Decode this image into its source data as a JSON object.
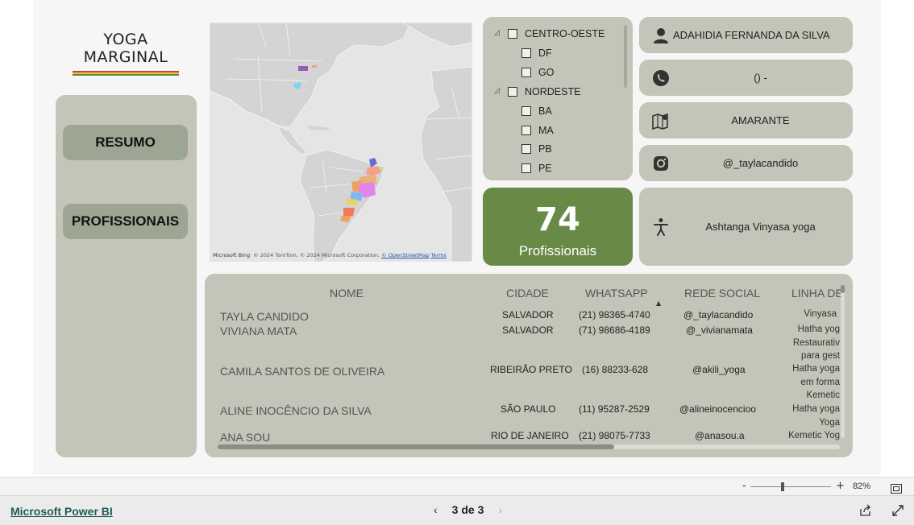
{
  "logo": {
    "line1": "YOGA",
    "line2": "MARGINAL"
  },
  "nav": {
    "resumo": "RESUMO",
    "profissionais": "PROFISSIONAIS"
  },
  "map": {
    "credit_text": "© 2024 TomTom, © 2024 Microsoft Corporation, ",
    "credit_link": "© OpenStreetMap",
    "terms": "Terms",
    "bing": "Microsoft Bing"
  },
  "slicer": {
    "items": [
      {
        "label": "CENTRO-OESTE",
        "level": 0
      },
      {
        "label": "DF",
        "level": 1
      },
      {
        "label": "GO",
        "level": 1
      },
      {
        "label": "NORDESTE",
        "level": 0
      },
      {
        "label": "BA",
        "level": 1
      },
      {
        "label": "MA",
        "level": 1
      },
      {
        "label": "PB",
        "level": 1
      },
      {
        "label": "PE",
        "level": 1
      }
    ]
  },
  "kpi": {
    "value": "74",
    "label": "Profissionais"
  },
  "info": {
    "name": "ADAHIDIA FERNANDA DA SILVA",
    "whatsapp": "() -",
    "city": "AMARANTE",
    "instagram": "@_taylacandido",
    "style": "Ashtanga Vinyasa yoga"
  },
  "table": {
    "headers": {
      "nome": "NOME",
      "cidade": "CIDADE",
      "whatsapp": "WHATSAPP",
      "rede": "REDE SOCIAL",
      "linha": "LINHA DE"
    },
    "rows": [
      {
        "nome": "TAYLA CANDIDO",
        "cidade": "SALVADOR",
        "whatsapp": "(21) 98365-4740",
        "rede": "@_taylacandido",
        "linha": [
          "Vinyasa"
        ]
      },
      {
        "nome": "VIVIANA MATA",
        "cidade": "SALVADOR",
        "whatsapp": "(71) 98686-4189",
        "rede": "@_vivianamata",
        "linha": [
          "Hatha yog",
          "Restaurativ",
          "para gest"
        ]
      },
      {
        "nome": "CAMILA SANTOS DE OLIVEIRA",
        "cidade": "RIBEIRÃO PRETO",
        "whatsapp": "(16) 88233-628",
        "rede": "@akili_yoga",
        "linha": [
          "Hatha yoga",
          "em forma",
          "Kemetic"
        ]
      },
      {
        "nome": "ALINE INOCÊNCIO DA SILVA",
        "cidade": "SÃO PAULO",
        "whatsapp": "(11) 95287-2529",
        "rede": "@alineinocencioo",
        "linha": [
          "Hatha yoga",
          "Yoga"
        ]
      },
      {
        "nome": "ANA SOU",
        "cidade": "RIO DE JANEIRO",
        "whatsapp": "(21) 98075-7733",
        "rede": "@anasou.a",
        "linha": [
          "Kemetic Yog"
        ]
      }
    ]
  },
  "zoom": {
    "minus": "-",
    "plus": "+",
    "level": "82%"
  },
  "footer": {
    "brand": "Microsoft Power BI",
    "page": "3 de 3"
  },
  "colors": {
    "panel": "#c3c5b8",
    "button": "#9da593",
    "kpi": "#698a47",
    "link": "#1e5c57"
  }
}
